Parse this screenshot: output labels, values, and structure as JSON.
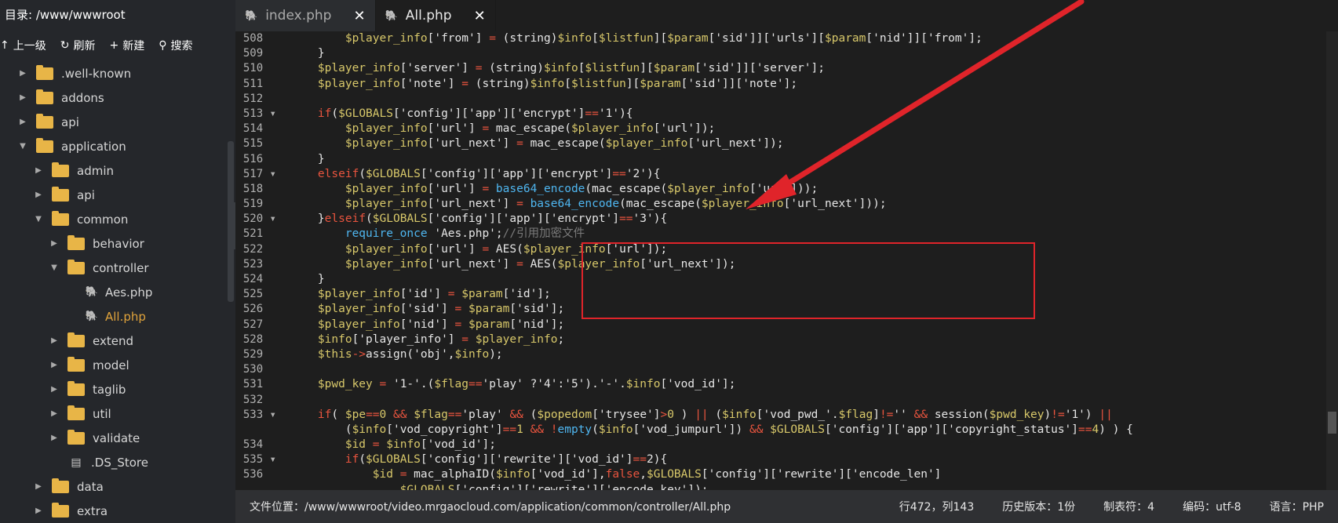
{
  "sidebar": {
    "dir_label": "目录: /www/wwwroot",
    "toolbar": [
      {
        "icon": "arrow-up-icon",
        "glyph": "↑",
        "label": "上一级"
      },
      {
        "icon": "refresh-icon",
        "glyph": "↻",
        "label": "刷新"
      },
      {
        "icon": "plus-icon",
        "glyph": "+",
        "label": "新建"
      },
      {
        "icon": "search-icon",
        "glyph": "⚲",
        "label": "搜索"
      }
    ],
    "tree": [
      {
        "label": ".well-known",
        "type": "folder",
        "depth": 1,
        "expanded": false
      },
      {
        "label": "addons",
        "type": "folder",
        "depth": 1,
        "expanded": false
      },
      {
        "label": "api",
        "type": "folder",
        "depth": 1,
        "expanded": false
      },
      {
        "label": "application",
        "type": "folder",
        "depth": 1,
        "expanded": true
      },
      {
        "label": "admin",
        "type": "folder",
        "depth": 2,
        "expanded": false
      },
      {
        "label": "api",
        "type": "folder",
        "depth": 2,
        "expanded": false
      },
      {
        "label": "common",
        "type": "folder",
        "depth": 2,
        "expanded": true
      },
      {
        "label": "behavior",
        "type": "folder",
        "depth": 3,
        "expanded": false
      },
      {
        "label": "controller",
        "type": "folder",
        "depth": 3,
        "expanded": true
      },
      {
        "label": "Aes.php",
        "type": "php",
        "depth": 4
      },
      {
        "label": "All.php",
        "type": "php",
        "depth": 4,
        "active": true
      },
      {
        "label": "extend",
        "type": "folder",
        "depth": 3,
        "expanded": false
      },
      {
        "label": "model",
        "type": "folder",
        "depth": 3,
        "expanded": false
      },
      {
        "label": "taglib",
        "type": "folder",
        "depth": 3,
        "expanded": false
      },
      {
        "label": "util",
        "type": "folder",
        "depth": 3,
        "expanded": false
      },
      {
        "label": "validate",
        "type": "folder",
        "depth": 3,
        "expanded": false
      },
      {
        "label": ".DS_Store",
        "type": "file",
        "depth": 3
      },
      {
        "label": "data",
        "type": "folder",
        "depth": 2,
        "expanded": false
      },
      {
        "label": "extra",
        "type": "folder",
        "depth": 2,
        "expanded": false
      }
    ]
  },
  "tabs": [
    {
      "label": "index.php",
      "active": false
    },
    {
      "label": "All.php",
      "active": true
    }
  ],
  "editor": {
    "lines": [
      {
        "n": "508",
        "fold": false,
        "html": "        <span class='var'>$player_info</span>['from'] <span class='op'>=</span> (string)<span class='var'>$info</span>[<span class='var'>$listfun</span>][<span class='var'>$param</span>['sid']]['urls'][<span class='var'>$param</span>['nid']]['from'];"
      },
      {
        "n": "509",
        "fold": false,
        "html": "    }"
      },
      {
        "n": "510",
        "fold": false,
        "html": "    <span class='var'>$player_info</span>['server'] <span class='op'>=</span> (string)<span class='var'>$info</span>[<span class='var'>$listfun</span>][<span class='var'>$param</span>['sid']]['server'];"
      },
      {
        "n": "511",
        "fold": false,
        "html": "    <span class='var'>$player_info</span>['note'] <span class='op'>=</span> (string)<span class='var'>$info</span>[<span class='var'>$listfun</span>][<span class='var'>$param</span>['sid']]['note'];"
      },
      {
        "n": "512",
        "fold": false,
        "html": ""
      },
      {
        "n": "513",
        "fold": true,
        "html": "    <span class='kw'>if</span>(<span class='var'>$GLOBALS</span>['config']['app']['encrypt']<span class='op'>==</span>'1'){"
      },
      {
        "n": "514",
        "fold": false,
        "html": "        <span class='var'>$player_info</span>['url'] <span class='op'>=</span> mac_escape(<span class='var'>$player_info</span>['url']);"
      },
      {
        "n": "515",
        "fold": false,
        "html": "        <span class='var'>$player_info</span>['url_next'] <span class='op'>=</span> mac_escape(<span class='var'>$player_info</span>['url_next']);"
      },
      {
        "n": "516",
        "fold": false,
        "html": "    }"
      },
      {
        "n": "517",
        "fold": true,
        "html": "    <span class='kw'>elseif</span>(<span class='var'>$GLOBALS</span>['config']['app']['encrypt']<span class='op'>==</span>'2'){"
      },
      {
        "n": "518",
        "fold": false,
        "html": "        <span class='var'>$player_info</span>['url'] <span class='op'>=</span> <span class='bi'>base64_encode</span>(mac_escape(<span class='var'>$player_info</span>['url']));"
      },
      {
        "n": "519",
        "fold": false,
        "html": "        <span class='var'>$player_info</span>['url_next'] <span class='op'>=</span> <span class='bi'>base64_encode</span>(mac_escape(<span class='var'>$player_info</span>['url_next']));"
      },
      {
        "n": "520",
        "fold": true,
        "html": "    }<span class='kw'>elseif</span>(<span class='var'>$GLOBALS</span>['config']['app']['encrypt']<span class='op'>==</span>'3'){"
      },
      {
        "n": "521",
        "fold": false,
        "html": "        <span class='bi'>require_once</span> 'Aes.php';<span class='cm'>//引用加密文件</span>"
      },
      {
        "n": "522",
        "fold": false,
        "html": "        <span class='var'>$player_info</span>['url'] <span class='op'>=</span> AES(<span class='var'>$player_info</span>['url']);"
      },
      {
        "n": "523",
        "fold": false,
        "html": "        <span class='var'>$player_info</span>['url_next'] <span class='op'>=</span> AES(<span class='var'>$player_info</span>['url_next']);"
      },
      {
        "n": "524",
        "fold": false,
        "html": "    }"
      },
      {
        "n": "525",
        "fold": false,
        "html": "    <span class='var'>$player_info</span>['id'] <span class='op'>=</span> <span class='var'>$param</span>['id'];"
      },
      {
        "n": "526",
        "fold": false,
        "html": "    <span class='var'>$player_info</span>['sid'] <span class='op'>=</span> <span class='var'>$param</span>['sid'];"
      },
      {
        "n": "527",
        "fold": false,
        "html": "    <span class='var'>$player_info</span>['nid'] <span class='op'>=</span> <span class='var'>$param</span>['nid'];"
      },
      {
        "n": "528",
        "fold": false,
        "html": "    <span class='var'>$info</span>['player_info'] <span class='op'>=</span> <span class='var'>$player_info</span>;"
      },
      {
        "n": "529",
        "fold": false,
        "html": "    <span class='var'>$this</span><span class='op'>-></span>assign('obj',<span class='var'>$info</span>);"
      },
      {
        "n": "530",
        "fold": false,
        "html": ""
      },
      {
        "n": "531",
        "fold": false,
        "html": "    <span class='var'>$pwd_key</span> <span class='op'>=</span> '1-'.(<span class='var'>$flag</span><span class='op'>==</span>'play' ?'4':'5').'-'.<span class='var'>$info</span>['vod_id'];"
      },
      {
        "n": "532",
        "fold": false,
        "html": ""
      },
      {
        "n": "533",
        "fold": true,
        "html": "    <span class='kw'>if</span>( <span class='var'>$pe</span><span class='op'>==</span><span class='num'>0</span> <span class='op'>&amp;&amp;</span> <span class='var'>$flag</span><span class='op'>==</span>'play' <span class='op'>&amp;&amp;</span> (<span class='var'>$popedom</span>['trysee']<span class='op'>></span><span class='num'>0</span> ) <span class='op'>||</span> (<span class='var'>$info</span>['vod_pwd_'.<span class='var'>$flag</span>]<span class='op'>!=</span>'' <span class='op'>&amp;&amp;</span> session(<span class='var'>$pwd_key</span>)<span class='op'>!=</span>'1') <span class='op'>||</span>"
      },
      {
        "n": "",
        "fold": false,
        "html": "        (<span class='var'>$info</span>['vod_copyright']<span class='op'>==</span><span class='num'>1</span> <span class='op'>&amp;&amp;</span> <span class='op'>!</span><span class='bi'>empty</span>(<span class='var'>$info</span>['vod_jumpurl']) <span class='op'>&amp;&amp;</span> <span class='var'>$GLOBALS</span>['config']['app']['copyright_status']<span class='op'>==</span><span class='num'>4</span>) ) {"
      },
      {
        "n": "534",
        "fold": false,
        "html": "        <span class='var'>$id</span> <span class='op'>=</span> <span class='var'>$info</span>['vod_id'];"
      },
      {
        "n": "535",
        "fold": true,
        "html": "        <span class='kw'>if</span>(<span class='var'>$GLOBALS</span>['config']['rewrite']['vod_id']<span class='op'>==</span>2){"
      },
      {
        "n": "536",
        "fold": false,
        "html": "            <span class='var'>$id</span> <span class='op'>=</span> mac_alphaID(<span class='var'>$info</span>['vod_id'],<span class='kw'>false</span>,<span class='var'>$GLOBALS</span>['config']['rewrite']['encode_len']"
      },
      {
        "n": "",
        "fold": false,
        "html": "                <span class='var'>$GLOBALS</span>['config']['rewrite']['encode_key']);"
      }
    ]
  },
  "statusbar": {
    "path": "文件位置：/www/wwwroot/video.mrgaocloud.com/application/common/controller/All.php",
    "cursor": "行472，列143",
    "history": "历史版本：1份",
    "tabsize": "制表符：4",
    "encoding": "编码：utf-8",
    "language": "语言：PHP"
  },
  "annotation_color": "#e0242a"
}
